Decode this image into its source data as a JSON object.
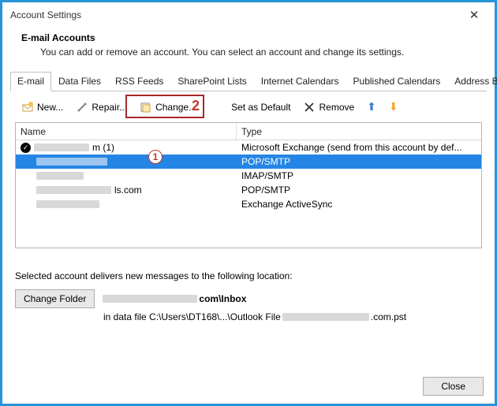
{
  "window": {
    "title": "Account Settings"
  },
  "header": {
    "title": "E-mail Accounts",
    "subtitle": "You can add or remove an account. You can select an account and change its settings."
  },
  "tabs": [
    {
      "label": "E-mail",
      "active": true
    },
    {
      "label": "Data Files"
    },
    {
      "label": "RSS Feeds"
    },
    {
      "label": "SharePoint Lists"
    },
    {
      "label": "Internet Calendars"
    },
    {
      "label": "Published Calendars"
    },
    {
      "label": "Address Books"
    }
  ],
  "toolbar": {
    "new_label": "New...",
    "repair_label": "Repair...",
    "change_label": "Change...",
    "default_label": "Set as Default",
    "remove_label": "Remove"
  },
  "callouts": {
    "one": "1",
    "two": "2"
  },
  "list": {
    "col_name": "Name",
    "col_type": "Type",
    "rows": [
      {
        "name_suffix": "m (1)",
        "type": "Microsoft Exchange (send from this account by def...",
        "default": true
      },
      {
        "type": "POP/SMTP",
        "selected": true
      },
      {
        "type": "IMAP/SMTP"
      },
      {
        "name_suffix": "ls.com",
        "type": "POP/SMTP"
      },
      {
        "type": "Exchange ActiveSync"
      }
    ]
  },
  "location": {
    "intro": "Selected account delivers new messages to the following location:",
    "change_folder": "Change Folder",
    "path_suffix": "com\\Inbox",
    "file_prefix": "in data file C:\\Users\\DT168\\...\\Outlook File",
    "file_suffix": ".com.pst"
  },
  "footer": {
    "close": "Close"
  }
}
